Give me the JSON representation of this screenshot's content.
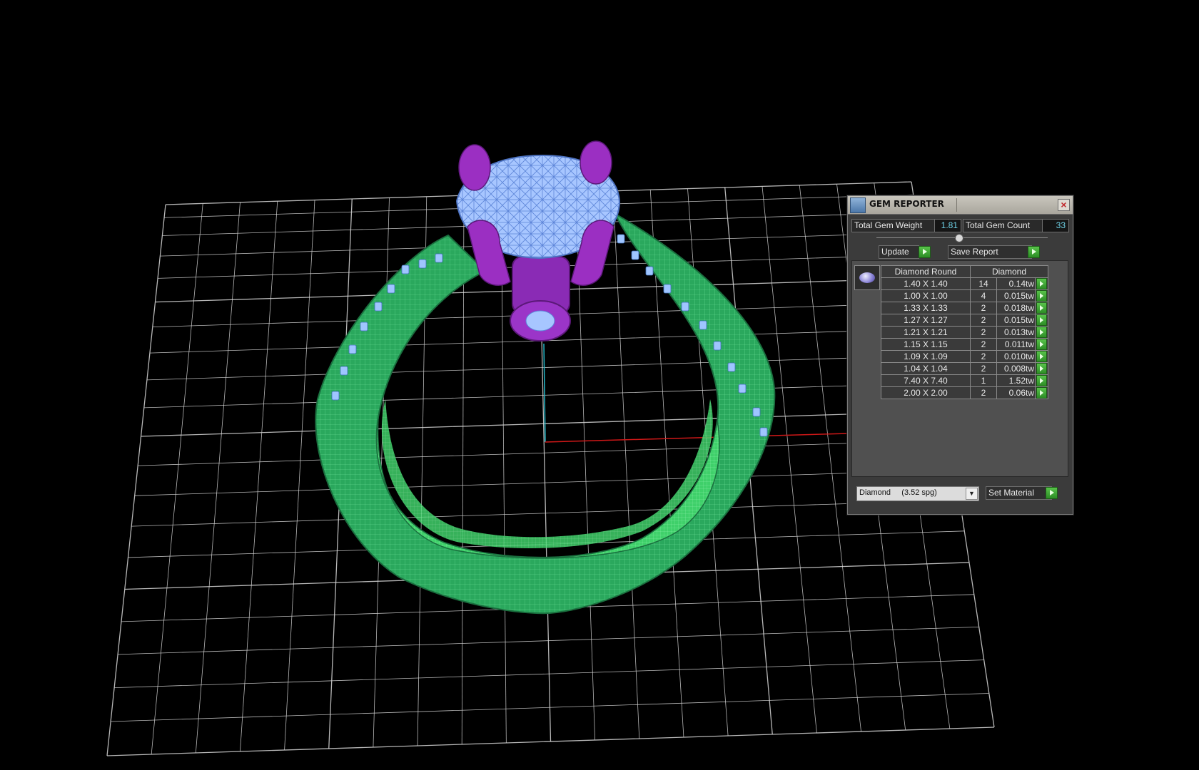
{
  "viewport": {
    "description_icon": "3d-viewport",
    "colors": {
      "background": "#000000",
      "grid": "#d8d8d8",
      "ring_band": "#2fbf6a",
      "ring_band_inner": "#43d36b",
      "center_stone": "#9fc5ff",
      "prongs": "#9b2fc2",
      "side_stones": "#9fc5ff",
      "axis_x": "#d01818",
      "axis_z": "#25b8c8"
    }
  },
  "panel": {
    "title": "GEM REPORTER",
    "app_icon": "gem-reporter-app-icon",
    "close_icon": "close-icon",
    "total_gem_weight_label": "Total Gem Weight",
    "total_gem_weight_value": "1.81",
    "total_gem_count_label": "Total Gem Count",
    "total_gem_count_value": "33",
    "update_label": "Update",
    "save_report_label": "Save Report",
    "table": {
      "headers": [
        "Diamond Round",
        "Diamond"
      ],
      "rows": [
        {
          "size": "1.40 X 1.40",
          "count": "14",
          "weight": "0.14tw"
        },
        {
          "size": "1.00 X 1.00",
          "count": "4",
          "weight": "0.015tw"
        },
        {
          "size": "1.33 X 1.33",
          "count": "2",
          "weight": "0.018tw"
        },
        {
          "size": "1.27 X 1.27",
          "count": "2",
          "weight": "0.015tw"
        },
        {
          "size": "1.21 X 1.21",
          "count": "2",
          "weight": "0.013tw"
        },
        {
          "size": "1.15 X 1.15",
          "count": "2",
          "weight": "0.011tw"
        },
        {
          "size": "1.09 X 1.09",
          "count": "2",
          "weight": "0.010tw"
        },
        {
          "size": "1.04 X 1.04",
          "count": "2",
          "weight": "0.008tw"
        },
        {
          "size": "7.40 X 7.40",
          "count": "1",
          "weight": "1.52tw"
        },
        {
          "size": "2.00 X 2.00",
          "count": "2",
          "weight": "0.06tw"
        }
      ]
    },
    "material_select": {
      "value": "Diamond     (3.52 spg)"
    },
    "set_material_label": "Set Material"
  }
}
